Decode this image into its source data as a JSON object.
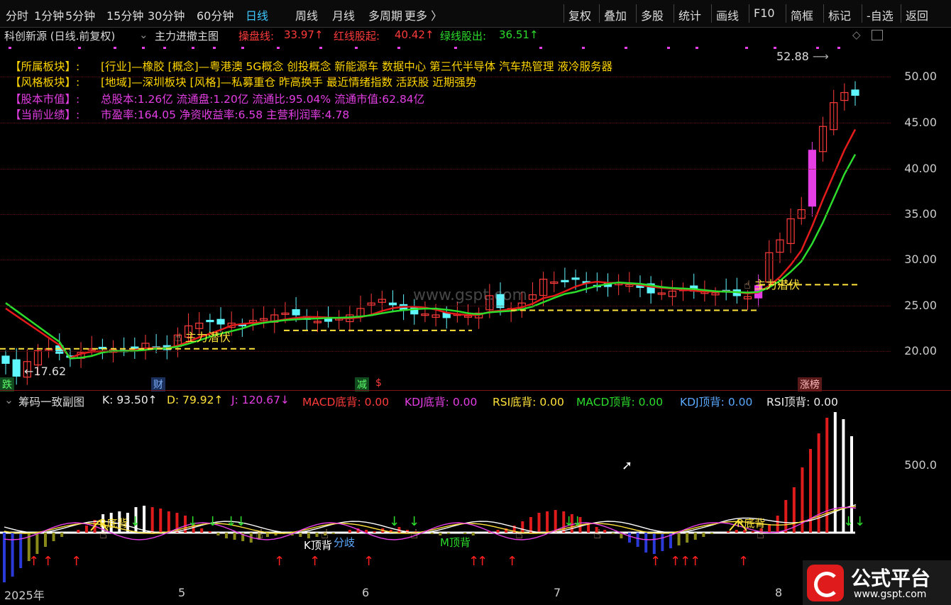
{
  "toolbar": {
    "left_items": [
      "分时",
      "1分钟",
      "5分钟",
      "15分钟",
      "30分钟",
      "60分钟",
      "日线",
      "周线",
      "月线",
      "多周期",
      "更多 〉"
    ],
    "active": "日线",
    "right_items": [
      "复权",
      "叠加",
      "多股",
      "统计",
      "画线",
      "F10",
      "简框",
      "标记",
      "-自选",
      "返回"
    ]
  },
  "main_header": {
    "stock": "科创新源 (日线.前复权)",
    "indicator": "主力进撤主图",
    "l1_label": "操盘线:",
    "l1_value": "33.97↑",
    "l2_label": "红线股起:",
    "l2_value": "40.42↑",
    "l3_label": "绿线股出:",
    "l3_value": "36.51↑"
  },
  "info": {
    "sector_label": "【所属板块】:",
    "sector_text": "[行业]—橡胶 [概念]—粤港澳 5G概念 创投概念 新能源车 数据中心 第三代半导体 汽车热管理 液冷服务器",
    "style_label": "【风格板块】:",
    "style_text": "[地域]—深圳板块 [风格]—私募重仓 昨高换手 最近情绪指数 活跃股 近期强势",
    "cap_label": "【股本市值】:",
    "cap_text": "总股本:1.26亿 流通盘:1.20亿 流通比:95.04% 流通市值:62.84亿",
    "perf_label": "【当前业绩】:",
    "perf_text": "市盈率:164.05 净资收益率:6.58 主营利润率:4.78"
  },
  "y_axis_main": [
    "50.00",
    "45.00",
    "40.00",
    "35.00",
    "30.00",
    "25.00",
    "20.00"
  ],
  "y_axis_sub": [
    "500.0"
  ],
  "annotations": {
    "high": "52.88",
    "low": "←17.62",
    "accum1": "主力潜伏",
    "accum2": "主力潜伏",
    "watermark": "www.gspt.com"
  },
  "event_tags": [
    "跌",
    "财",
    "减",
    "$",
    "涨榜"
  ],
  "sub_header": {
    "name": "筹码一致副图",
    "k": "K: 93.50↑",
    "d": "D: 79.92↑",
    "j": "J: 120.67↓",
    "macd_bottom": "MACD底背: 0.00",
    "kdj_bottom": "KDJ底背: 0.00",
    "rsi_bottom": "RSI底背: 0.00",
    "macd_top": "MACD顶背: 0.00",
    "kdj_top": "KDJ顶背: 0.00",
    "rsi_top": "RSI顶背: 0.00"
  },
  "sub_labels": [
    "R底背",
    "R底背",
    "K顶背",
    "分歧",
    "M顶背"
  ],
  "x_axis": [
    "2025年",
    "5",
    "6",
    "7",
    "8"
  ],
  "logo": {
    "text": "公式平台",
    "url": "www.gspt.com"
  },
  "colors": {
    "up": "#ff3b3b",
    "down": "#5ff7ff",
    "ma_red": "#e41b1b",
    "ma_green": "#2cdd2c",
    "dash": "#ffe23a",
    "magenta": "#e43ee4"
  }
}
